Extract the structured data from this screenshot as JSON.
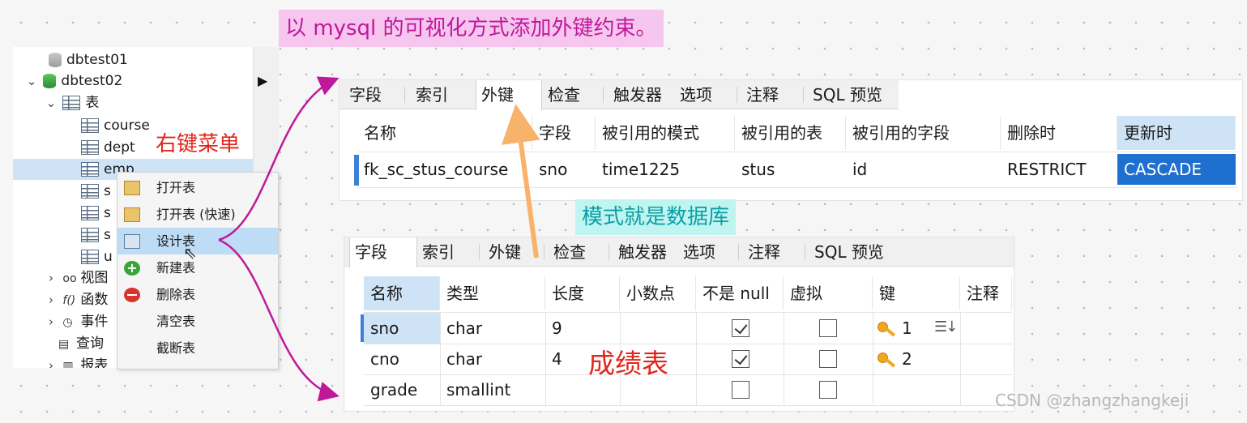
{
  "title": "以 mysql 的可视化方式添加外键约束。",
  "tree": {
    "items": [
      {
        "label": "dbtest01",
        "icon": "database-grey-icon"
      },
      {
        "label": "dbtest02",
        "icon": "database-green-icon"
      },
      {
        "label": "表",
        "icon": "table-folder-icon"
      },
      {
        "label": "course",
        "icon": "table-icon"
      },
      {
        "label": "dept",
        "icon": "table-icon"
      },
      {
        "label": "emp",
        "icon": "table-icon"
      },
      {
        "label": "s",
        "icon": "table-icon"
      },
      {
        "label": "s",
        "icon": "table-icon"
      },
      {
        "label": "s",
        "icon": "table-icon"
      },
      {
        "label": "u",
        "icon": "table-icon"
      },
      {
        "label": "视图",
        "icon": "view-icon"
      },
      {
        "label": "函数",
        "icon": "function-icon"
      },
      {
        "label": "事件",
        "icon": "event-icon"
      },
      {
        "label": "查询",
        "icon": "query-icon"
      },
      {
        "label": "报表",
        "icon": "report-icon"
      }
    ]
  },
  "right_click_label": "右键菜单",
  "context_menu": {
    "items": [
      {
        "label": "打开表",
        "icon": "open-table-icon"
      },
      {
        "label": "打开表 (快速)",
        "icon": "open-table-fast-icon"
      },
      {
        "label": "设计表",
        "icon": "design-table-icon"
      },
      {
        "label": "新建表",
        "icon": "new-table-icon"
      },
      {
        "label": "删除表",
        "icon": "delete-table-icon"
      },
      {
        "label": "清空表",
        "icon": ""
      },
      {
        "label": "截断表",
        "icon": ""
      }
    ]
  },
  "fk_panel": {
    "tabs": [
      "字段",
      "索引",
      "外键",
      "检查",
      "触发器",
      "选项",
      "注释",
      "SQL 预览"
    ],
    "active_tab": "外键",
    "columns": [
      "名称",
      "字段",
      "被引用的模式",
      "被引用的表",
      "被引用的字段",
      "删除时",
      "更新时"
    ],
    "rows": [
      [
        "fk_sc_stus_course",
        "sno",
        "time1225",
        "stus",
        "id",
        "RESTRICT",
        "CASCADE"
      ]
    ]
  },
  "schema_note": "模式就是数据库",
  "fields_panel": {
    "tabs": [
      "字段",
      "索引",
      "外键",
      "检查",
      "触发器",
      "选项",
      "注释",
      "SQL 预览"
    ],
    "active_tab": "字段",
    "columns": [
      "名称",
      "类型",
      "长度",
      "小数点",
      "不是 null",
      "虚拟",
      "键",
      "注释"
    ],
    "rows": [
      {
        "name": "sno",
        "type": "char",
        "length": "9",
        "decimals": "",
        "not_null": true,
        "virtual": false,
        "key": "1"
      },
      {
        "name": "cno",
        "type": "char",
        "length": "4",
        "decimals": "",
        "not_null": true,
        "virtual": false,
        "key": "2"
      },
      {
        "name": "grade",
        "type": "smallint",
        "length": "",
        "decimals": "",
        "not_null": false,
        "virtual": false,
        "key": ""
      }
    ]
  },
  "grades_table_label": "成绩表",
  "watermark": "CSDN @zhangzhangkeji",
  "colors": {
    "selection_blue": "#1e6fcf",
    "highlight_light_blue": "#cfe3f6",
    "annotation_magenta": "#c0189a",
    "annotation_red": "#e1261c",
    "annotation_teal": "#0aa0a5",
    "arrow_orange": "#f7b36a"
  }
}
